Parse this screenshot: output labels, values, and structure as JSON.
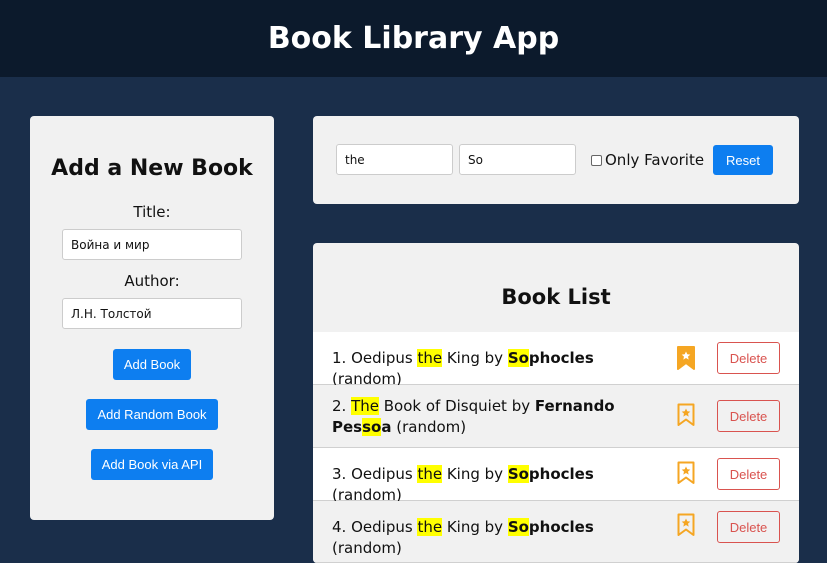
{
  "app": {
    "title": "Book Library App"
  },
  "add_form": {
    "heading": "Add a New Book",
    "title_label": "Title:",
    "title_value": "Война и мир",
    "author_label": "Author:",
    "author_value": "Л.Н. Толстой",
    "add_button": "Add Book",
    "add_random_button": "Add Random Book",
    "add_api_button": "Add Book via API"
  },
  "filters": {
    "title_filter_value": "the",
    "author_filter_value": "So",
    "only_favorite_label": "Only Favorite",
    "only_favorite_checked": false,
    "reset_button": "Reset"
  },
  "book_list": {
    "heading": "Book List",
    "delete_label": "Delete",
    "books": [
      {
        "index": "1.",
        "title_parts": [
          "Oedipus ",
          "the",
          " King"
        ],
        "by": " by ",
        "author_parts": [
          "So",
          "phocles"
        ],
        "suffix": " (random)",
        "favorite": true
      },
      {
        "index": "2.",
        "title_parts": [
          "",
          "The",
          " Book of Disquiet"
        ],
        "by": " by ",
        "author_parts": [
          "Fernando Pes",
          "so",
          "a"
        ],
        "suffix": " (random)",
        "favorite": false
      },
      {
        "index": "3.",
        "title_parts": [
          "Oedipus ",
          "the",
          " King"
        ],
        "by": " by ",
        "author_parts": [
          "So",
          "phocles"
        ],
        "suffix": " (random)",
        "favorite": false
      },
      {
        "index": "4.",
        "title_parts": [
          "Oedipus ",
          "the",
          " King"
        ],
        "by": " by ",
        "author_parts": [
          "So",
          "phocles"
        ],
        "suffix": " (random)",
        "favorite": false
      }
    ]
  },
  "colors": {
    "header_bg": "#0c1a2c",
    "page_bg": "#1a2e4a",
    "primary": "#0d7ef0",
    "danger": "#d9534f",
    "favorite": "#f5a623",
    "highlight": "#ffff00"
  },
  "icons": {
    "bookmark_filled": "bookmark-star-filled-icon",
    "bookmark_outline": "bookmark-star-outline-icon"
  }
}
